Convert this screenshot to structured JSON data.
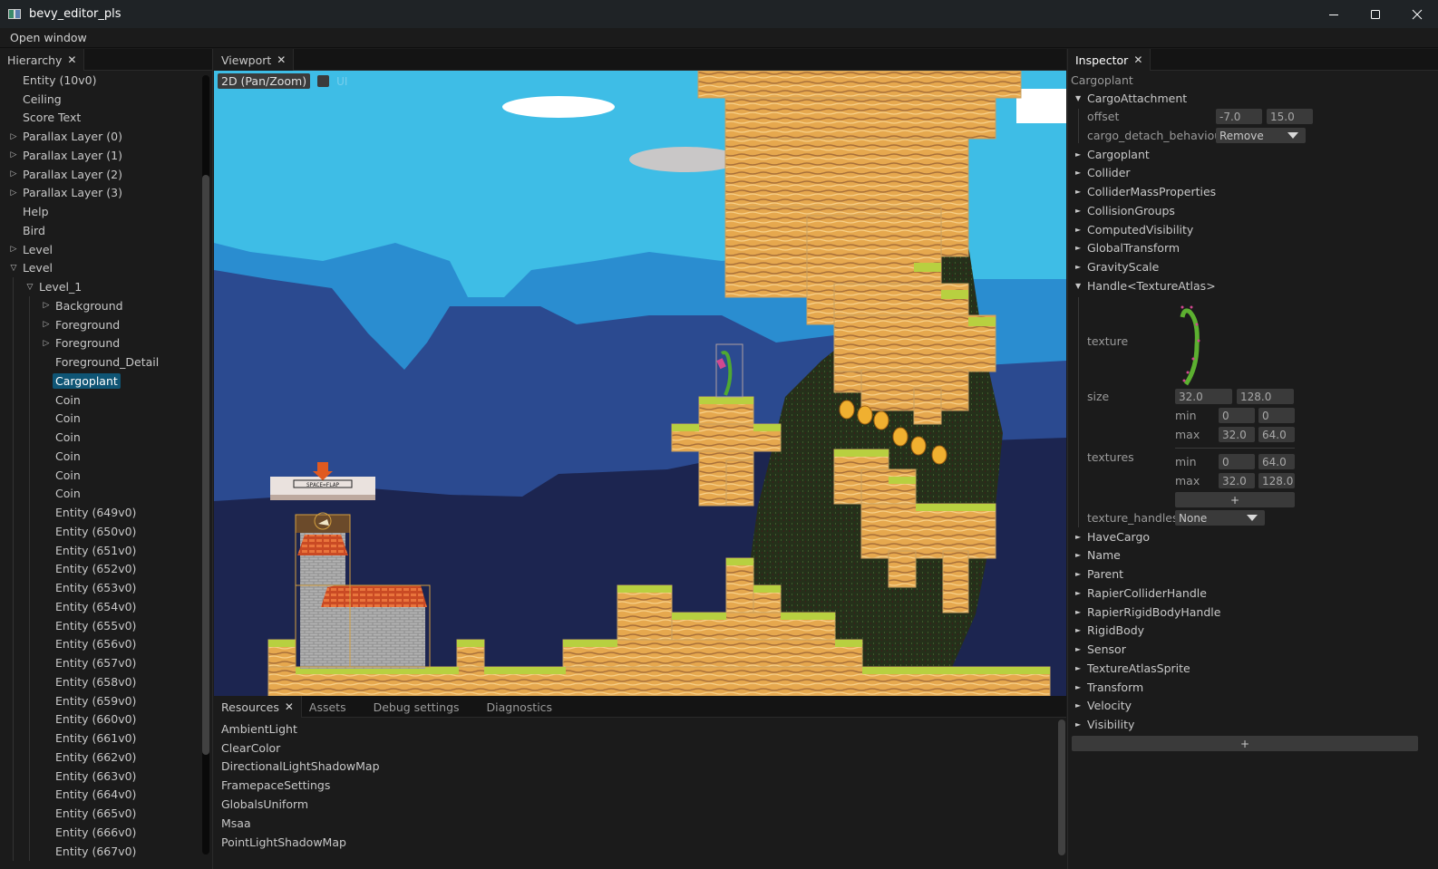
{
  "window": {
    "title": "bevy_editor_pls",
    "controls": {
      "minimize": "minimize-icon",
      "maximize": "maximize-icon",
      "close": "close-icon"
    }
  },
  "menubar": {
    "items": [
      "Open window"
    ]
  },
  "hierarchy": {
    "tab_label": "Hierarchy",
    "items": [
      {
        "label": "Entity (10v0)",
        "depth": 0,
        "expander": "none"
      },
      {
        "label": "Ceiling",
        "depth": 0,
        "expander": "none"
      },
      {
        "label": "Score Text",
        "depth": 0,
        "expander": "none"
      },
      {
        "label": "Parallax Layer (0)",
        "depth": 0,
        "expander": "collapsed"
      },
      {
        "label": "Parallax Layer (1)",
        "depth": 0,
        "expander": "collapsed"
      },
      {
        "label": "Parallax Layer (2)",
        "depth": 0,
        "expander": "collapsed"
      },
      {
        "label": "Parallax Layer (3)",
        "depth": 0,
        "expander": "collapsed"
      },
      {
        "label": "Help",
        "depth": 0,
        "expander": "none"
      },
      {
        "label": "Bird",
        "depth": 0,
        "expander": "none"
      },
      {
        "label": "Level",
        "depth": 0,
        "expander": "collapsed"
      },
      {
        "label": "Level",
        "depth": 0,
        "expander": "expanded"
      },
      {
        "label": "Level_1",
        "depth": 1,
        "expander": "expanded"
      },
      {
        "label": "Background",
        "depth": 2,
        "expander": "collapsed"
      },
      {
        "label": "Foreground",
        "depth": 2,
        "expander": "collapsed"
      },
      {
        "label": "Foreground",
        "depth": 2,
        "expander": "collapsed"
      },
      {
        "label": "Foreground_Detail",
        "depth": 2,
        "expander": "none"
      },
      {
        "label": "Cargoplant",
        "depth": 2,
        "expander": "none",
        "selected": true
      },
      {
        "label": "Coin",
        "depth": 2,
        "expander": "none"
      },
      {
        "label": "Coin",
        "depth": 2,
        "expander": "none"
      },
      {
        "label": "Coin",
        "depth": 2,
        "expander": "none"
      },
      {
        "label": "Coin",
        "depth": 2,
        "expander": "none"
      },
      {
        "label": "Coin",
        "depth": 2,
        "expander": "none"
      },
      {
        "label": "Coin",
        "depth": 2,
        "expander": "none"
      },
      {
        "label": "Entity (649v0)",
        "depth": 2,
        "expander": "none"
      },
      {
        "label": "Entity (650v0)",
        "depth": 2,
        "expander": "none"
      },
      {
        "label": "Entity (651v0)",
        "depth": 2,
        "expander": "none"
      },
      {
        "label": "Entity (652v0)",
        "depth": 2,
        "expander": "none"
      },
      {
        "label": "Entity (653v0)",
        "depth": 2,
        "expander": "none"
      },
      {
        "label": "Entity (654v0)",
        "depth": 2,
        "expander": "none"
      },
      {
        "label": "Entity (655v0)",
        "depth": 2,
        "expander": "none"
      },
      {
        "label": "Entity (656v0)",
        "depth": 2,
        "expander": "none"
      },
      {
        "label": "Entity (657v0)",
        "depth": 2,
        "expander": "none"
      },
      {
        "label": "Entity (658v0)",
        "depth": 2,
        "expander": "none"
      },
      {
        "label": "Entity (659v0)",
        "depth": 2,
        "expander": "none"
      },
      {
        "label": "Entity (660v0)",
        "depth": 2,
        "expander": "none"
      },
      {
        "label": "Entity (661v0)",
        "depth": 2,
        "expander": "none"
      },
      {
        "label": "Entity (662v0)",
        "depth": 2,
        "expander": "none"
      },
      {
        "label": "Entity (663v0)",
        "depth": 2,
        "expander": "none"
      },
      {
        "label": "Entity (664v0)",
        "depth": 2,
        "expander": "none"
      },
      {
        "label": "Entity (665v0)",
        "depth": 2,
        "expander": "none"
      },
      {
        "label": "Entity (666v0)",
        "depth": 2,
        "expander": "none"
      },
      {
        "label": "Entity (667v0)",
        "depth": 2,
        "expander": "none"
      }
    ]
  },
  "viewport": {
    "tab_label": "Viewport",
    "camera_mode": "2D (Pan/Zoom)",
    "ui_toggle_label": "UI",
    "ui_toggle_checked": false,
    "scene": {
      "help_sign_text": "SPACE=FLAP",
      "sky_color": "#3ebde6",
      "coin_count_visible": 6
    }
  },
  "bottom_panel": {
    "tabs": [
      {
        "label": "Resources",
        "active": true,
        "closable": true
      },
      {
        "label": "Assets"
      },
      {
        "label": "Debug settings"
      },
      {
        "label": "Diagnostics"
      }
    ],
    "resources": [
      "AmbientLight",
      "ClearColor",
      "DirectionalLightShadowMap",
      "FramepaceSettings",
      "GlobalsUniform",
      "Msaa",
      "PointLightShadowMap"
    ]
  },
  "inspector": {
    "tab_label": "Inspector",
    "entity_name": "Cargoplant",
    "cargo_attachment": {
      "label": "CargoAttachment",
      "offset_label": "offset",
      "offset": [
        "-7.0",
        "15.0"
      ],
      "detach_label": "cargo_detach_behaviour",
      "detach_value": "Remove"
    },
    "components_before": [
      "Cargoplant",
      "Collider",
      "ColliderMassProperties",
      "CollisionGroups",
      "ComputedVisibility",
      "GlobalTransform",
      "GravityScale"
    ],
    "texture_atlas": {
      "label": "Handle<TextureAtlas>",
      "texture_label": "texture",
      "size_label": "size",
      "size": [
        "32.0",
        "128.0"
      ],
      "min_label": "min",
      "max_label": "max",
      "size_min": [
        "0",
        "0"
      ],
      "size_max": [
        "32.0",
        "64.0"
      ],
      "textures_label": "textures",
      "textures_min": [
        "0",
        "64.0"
      ],
      "textures_max": [
        "32.0",
        "128.0"
      ],
      "add_label": "+",
      "texture_handles_label": "texture_handles",
      "texture_handles_value": "None"
    },
    "components_after": [
      "HaveCargo",
      "Name",
      "Parent",
      "RapierColliderHandle",
      "RapierRigidBodyHandle",
      "RigidBody",
      "Sensor",
      "TextureAtlasSprite",
      "Transform",
      "Velocity",
      "Visibility"
    ],
    "add_component_label": "+"
  }
}
